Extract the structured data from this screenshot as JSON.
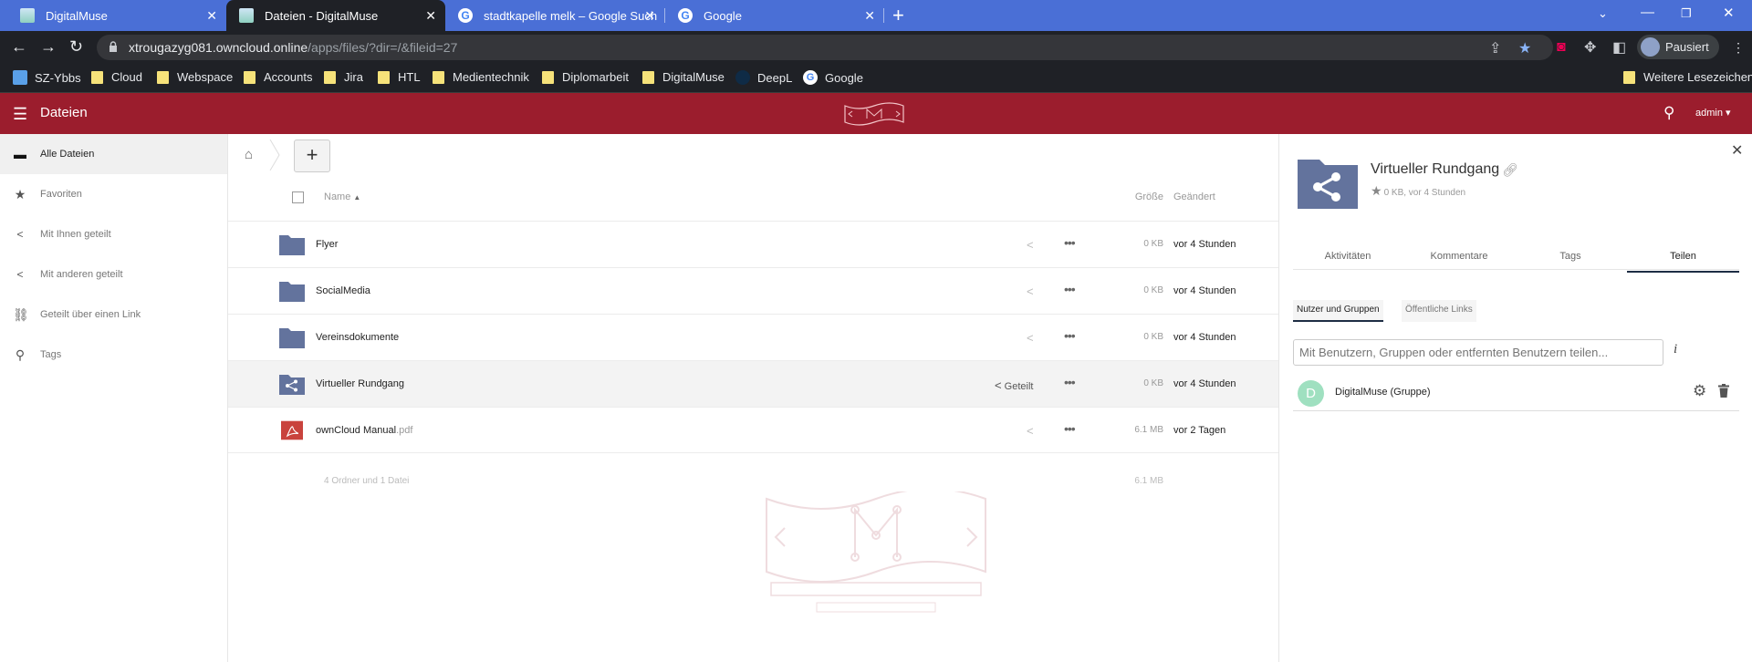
{
  "browser": {
    "tabs": [
      {
        "title": "DigitalMuse",
        "icon": "digitalmuse-favicon"
      },
      {
        "title": "Dateien - DigitalMuse",
        "icon": "digitalmuse-favicon"
      },
      {
        "title": "stadtkapelle melk – Google Such",
        "icon": "google-favicon"
      },
      {
        "title": "Google",
        "icon": "google-favicon"
      }
    ],
    "url_host": "xtrougazyg081.owncloud.online",
    "url_path": "/apps/files/?dir=/&fileid=27",
    "profile_label": "Pausiert",
    "bookmarks": [
      "SZ-Ybbs",
      "Cloud",
      "Webspace",
      "Accounts",
      "Jira",
      "HTL",
      "Medientechnik",
      "Diplomarbeit",
      "DigitalMuse",
      "DeepL",
      "Google"
    ],
    "other_bookmarks": "Weitere Lesezeichen"
  },
  "header": {
    "app_title": "Dateien",
    "user": "admin",
    "brand_color": "#9b1d2d"
  },
  "nav": [
    {
      "label": "Alle Dateien",
      "icon": "folder-icon"
    },
    {
      "label": "Favoriten",
      "icon": "star-icon"
    },
    {
      "label": "Mit Ihnen geteilt",
      "icon": "share-icon"
    },
    {
      "label": "Mit anderen geteilt",
      "icon": "share-icon"
    },
    {
      "label": "Geteilt über einen Link",
      "icon": "link-icon"
    },
    {
      "label": "Tags",
      "icon": "tag-icon"
    }
  ],
  "filelist": {
    "col_name": "Name",
    "col_size": "Größe",
    "col_modified": "Geändert",
    "rows": [
      {
        "name": "Flyer",
        "ext": "",
        "size": "0 KB",
        "modified": "vor 4 Stunden",
        "type": "folder"
      },
      {
        "name": "SocialMedia",
        "ext": "",
        "size": "0 KB",
        "modified": "vor 4 Stunden",
        "type": "folder"
      },
      {
        "name": "Vereinsdokumente",
        "ext": "",
        "size": "0 KB",
        "modified": "vor 4 Stunden",
        "type": "folder"
      },
      {
        "name": "Virtueller Rundgang",
        "ext": "",
        "size": "0 KB",
        "modified": "vor 4 Stunden",
        "type": "shared-folder",
        "shared_label": "Geteilt"
      },
      {
        "name": "ownCloud Manual",
        "ext": ".pdf",
        "size": "6.1 MB",
        "modified": "vor 2 Tagen",
        "type": "pdf"
      }
    ],
    "summary_text": "4 Ordner und 1 Datei",
    "summary_size": "6.1 MB"
  },
  "sidebar": {
    "title": "Virtueller Rundgang",
    "meta": "0 KB, vor 4 Stunden",
    "tabs": [
      "Aktivitäten",
      "Kommentare",
      "Tags",
      "Teilen"
    ],
    "active_tab": "Teilen",
    "subtabs": [
      "Nutzer und Gruppen",
      "Öffentliche Links"
    ],
    "share_placeholder": "Mit Benutzern, Gruppen oder entfernten Benutzern teilen...",
    "sharee": {
      "initial": "D",
      "name": "DigitalMuse (Gruppe)"
    }
  }
}
